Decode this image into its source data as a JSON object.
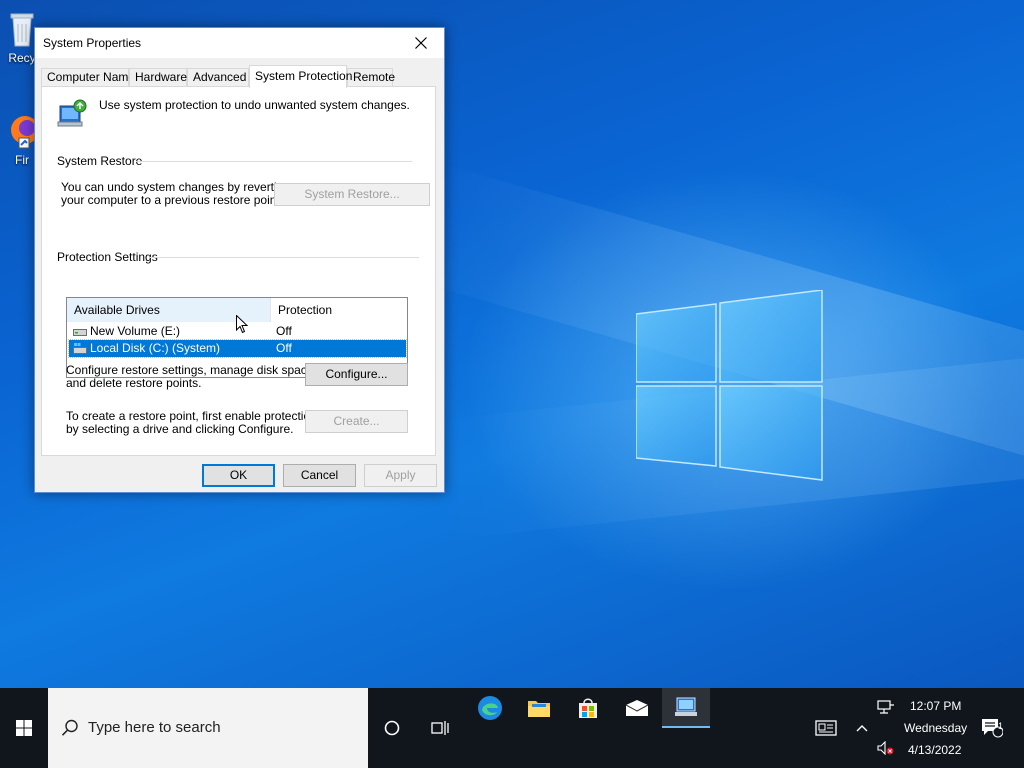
{
  "desktop": {
    "icons": [
      {
        "label": "Recy",
        "name": "recycle-bin"
      },
      {
        "label": "Fir",
        "name": "firefox"
      }
    ]
  },
  "dialog": {
    "title": "System Properties",
    "tabs": [
      "Computer Name",
      "Hardware",
      "Advanced",
      "System Protection",
      "Remote"
    ],
    "active_tab": "System Protection",
    "intro": "Use system protection to undo unwanted system changes.",
    "system_restore": {
      "heading": "System Restore",
      "text_line1": "You can undo system changes by reverting",
      "text_line2": "your computer to a previous restore point.",
      "button": "System Restore..."
    },
    "protection_settings": {
      "heading": "Protection Settings",
      "columns": [
        "Available Drives",
        "Protection"
      ],
      "rows": [
        {
          "drive": "New Volume (E:)",
          "protection": "Off",
          "selected": false
        },
        {
          "drive": "Local Disk (C:) (System)",
          "protection": "Off",
          "selected": true
        }
      ],
      "configure_text_line1": "Configure restore settings, manage disk space,",
      "configure_text_line2": "and delete restore points.",
      "configure_button": "Configure...",
      "create_text_line1": "To create a restore point, first enable protection",
      "create_text_line2": "by selecting a drive and clicking Configure.",
      "create_button": "Create..."
    },
    "buttons": {
      "ok": "OK",
      "cancel": "Cancel",
      "apply": "Apply"
    }
  },
  "taskbar": {
    "search_placeholder": "Type here to search",
    "clock": {
      "time": "12:07 PM",
      "day": "Wednesday",
      "date": "4/13/2022"
    },
    "notification_count": "1"
  },
  "colors": {
    "accent": "#0078d7",
    "taskbar": "#11161d",
    "desktop_blue": "#0a64d2"
  }
}
